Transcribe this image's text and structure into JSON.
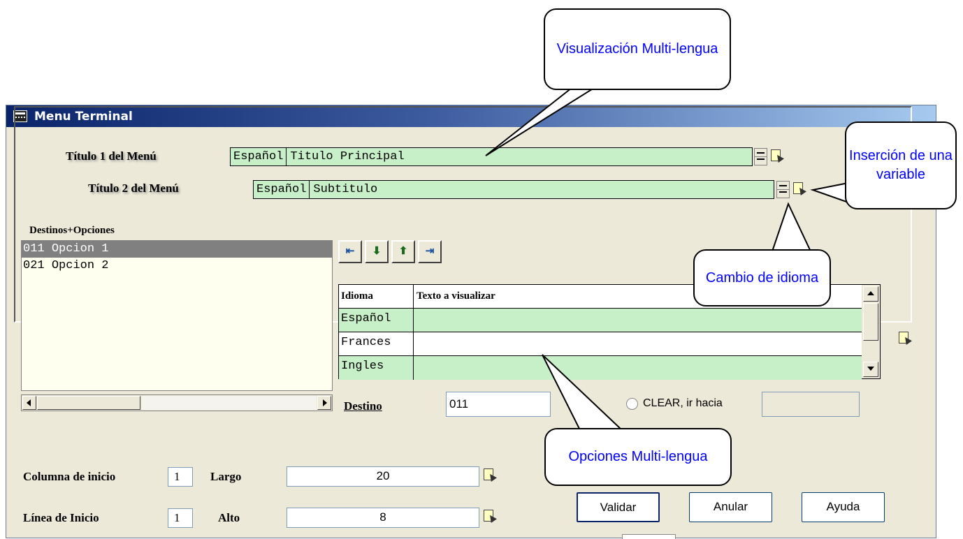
{
  "window": {
    "title": "Menu Terminal"
  },
  "titles": {
    "t1_label": "Título 1 del Menú",
    "t1_lang": "Español",
    "t1_value": "Titulo Principal",
    "t2_label": "Título 2 del Menú",
    "t2_lang": "Español",
    "t2_value": "Subtitulo"
  },
  "destinos": {
    "label": "Destinos+Opciones",
    "items": [
      {
        "code": "011",
        "text": "Opcion 1",
        "selected": true
      },
      {
        "code": "021",
        "text": "Opcion 2",
        "selected": false
      }
    ]
  },
  "toolbar": {
    "insert_icon": "insert-row-icon",
    "down_icon": "arrow-down-icon",
    "up_icon": "arrow-up-icon",
    "delete_icon": "delete-row-icon"
  },
  "grid": {
    "headers": [
      "Idioma",
      "Texto a visualizar"
    ],
    "rows": [
      {
        "idioma": "Español",
        "texto": ""
      },
      {
        "idioma": "Frances",
        "texto": ""
      },
      {
        "idioma": "Ingles",
        "texto": ""
      }
    ]
  },
  "destino": {
    "label": "Destino",
    "value": "011",
    "clear_label": "CLEAR, ir hacia",
    "clear_value": ""
  },
  "layout_fields": {
    "columna_label": "Columna de inicio",
    "columna_value": "1",
    "largo_label": "Largo",
    "largo_value": "20",
    "linea_label": "Línea de Inicio",
    "linea_value": "1",
    "alto_label": "Alto",
    "alto_value": "8"
  },
  "buttons": {
    "validar": "Validar",
    "anular": "Anular",
    "ayuda": "Ayuda"
  },
  "callouts": {
    "visualizacion": "Visualización Multi-lengua",
    "insercion": "Inserción de una variable",
    "cambio": "Cambio de idioma",
    "opciones": "Opciones Multi-lengua"
  },
  "colors": {
    "field_bg": "#c8f0c8",
    "callout_text": "#0000ff",
    "titlebar": "#0a246a"
  }
}
